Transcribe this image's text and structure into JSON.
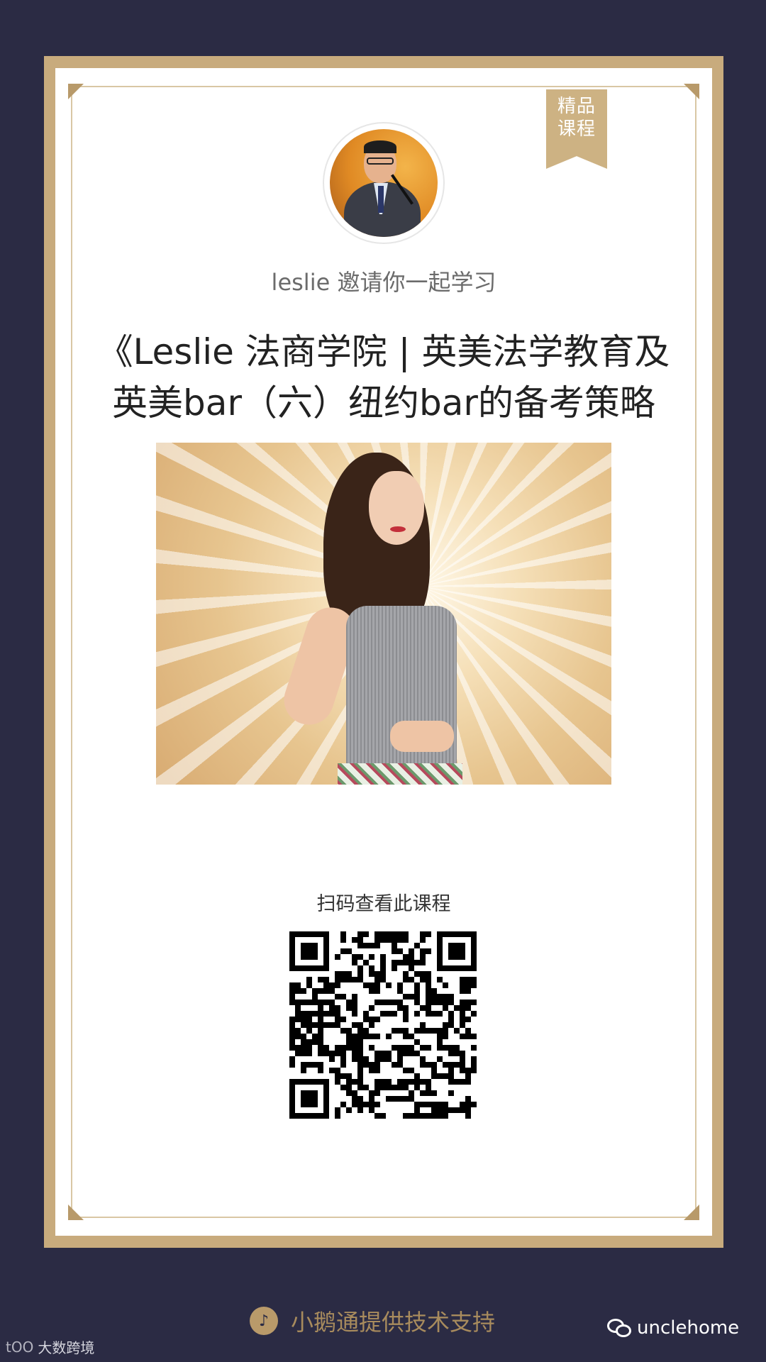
{
  "ribbon": {
    "line1": "精品",
    "line2": "课程"
  },
  "inviter": {
    "text": "leslie 邀请你一起学习"
  },
  "course": {
    "title": "《Leslie 法商学院 | 英美法学教育及英美bar（六）纽约bar的备考策略"
  },
  "qr": {
    "label": "扫码查看此课程"
  },
  "footer": {
    "support_text": "小鹅通提供技术支持"
  },
  "watermarks": {
    "wechat_account": "unclehome",
    "corner_brand": "大数跨境",
    "corner_logo": "tOO"
  },
  "colors": {
    "background": "#2b2b44",
    "frame_gold": "#c8ab7d",
    "accent_gold": "#a88b5d"
  },
  "icons": [
    "tiktok-logo-icon",
    "wechat-icon"
  ]
}
